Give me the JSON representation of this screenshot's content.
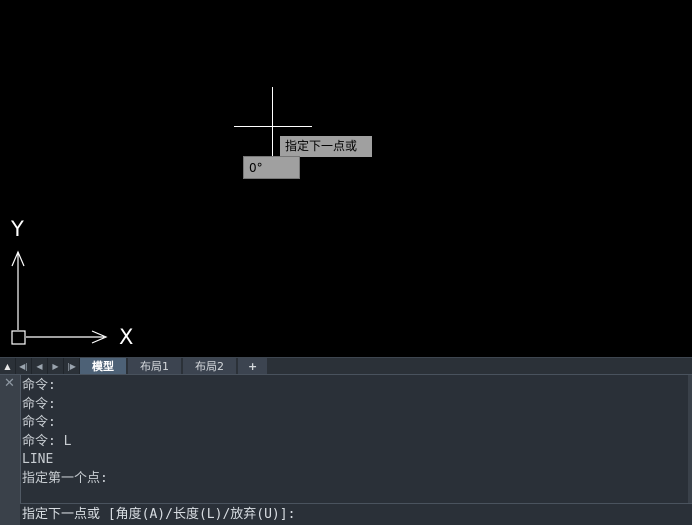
{
  "canvas": {
    "background": "#000000",
    "cursor_prompt": "指定下一点或",
    "angle_readout": "0°",
    "ucs": {
      "y_label": "Y",
      "x_label": "X"
    }
  },
  "tabbar": {
    "nav_icons": [
      "arrow-up-icon",
      "first-icon",
      "prev-icon",
      "next-icon",
      "last-icon"
    ],
    "tabs": [
      {
        "label": "模型",
        "active": true
      },
      {
        "label": "布局1",
        "active": false
      },
      {
        "label": "布局2",
        "active": false
      }
    ],
    "add_label": "+"
  },
  "command": {
    "close_icon": "close-icon",
    "history": [
      "命令:",
      "命令:",
      "命令:",
      "命令: L",
      "LINE",
      "指定第一个点:"
    ],
    "prompt": "指定下一点或 [角度(A)/长度(L)/放弃(U)]:"
  },
  "colors": {
    "canvas": "#000000",
    "panel": "#2a3038",
    "active_tab": "#4d6176",
    "tooltip": "#a0a0a0"
  }
}
